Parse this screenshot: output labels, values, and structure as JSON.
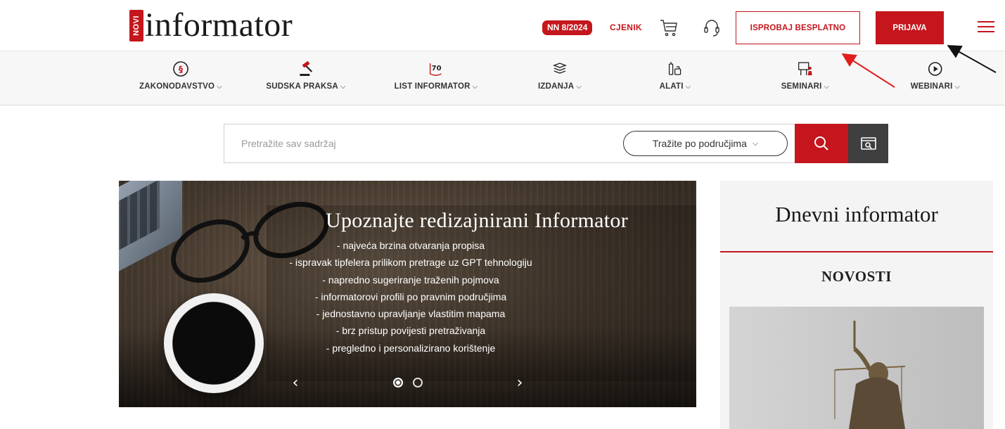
{
  "header": {
    "logo_badge": "NOVI",
    "logo_text": "informator",
    "nn_badge": "NN 8/2024",
    "pricing_link": "CJENIK",
    "try_button": "ISPROBAJ BESPLATNO",
    "login_button": "PRIJAVA"
  },
  "nav": {
    "items": [
      {
        "label": "ZAKONODAVSTVO",
        "icon": "paragraph-icon"
      },
      {
        "label": "SUDSKA PRAKSA",
        "icon": "gavel-icon"
      },
      {
        "label": "LIST INFORMATOR",
        "icon": "list-70-icon"
      },
      {
        "label": "IZDANJA",
        "icon": "books-icon"
      },
      {
        "label": "ALATI",
        "icon": "tools-icon"
      },
      {
        "label": "SEMINARI",
        "icon": "seminar-icon"
      },
      {
        "label": "WEBINARI",
        "icon": "play-icon"
      }
    ],
    "icon_70": "70"
  },
  "search": {
    "placeholder": "Pretražite sav sadržaj",
    "area_select": "Tražite po područjima"
  },
  "hero": {
    "title": "Upoznajte redizajnirani Informator",
    "lines": [
      "- najveća brzina otvaranja propisa",
      "- ispravak tipfelera prilikom pretrage uz GPT tehnologiju",
      "- napredno sugeriranje traženih pojmova",
      "- informatorovi profili po pravnim područjima",
      "- jednostavno upravljanje vlastitim mapama",
      "- brz pristup povijesti pretraživanja",
      "- pregledno i personalizirano korištenje"
    ],
    "prev": "‹",
    "next": "›",
    "slide_count": 2,
    "active_slide": 1
  },
  "side": {
    "title": "Dnevni informator",
    "subtitle": "NOVOSTI"
  },
  "colors": {
    "brand_red": "#c4161c",
    "dark": "#3f3f3f"
  }
}
